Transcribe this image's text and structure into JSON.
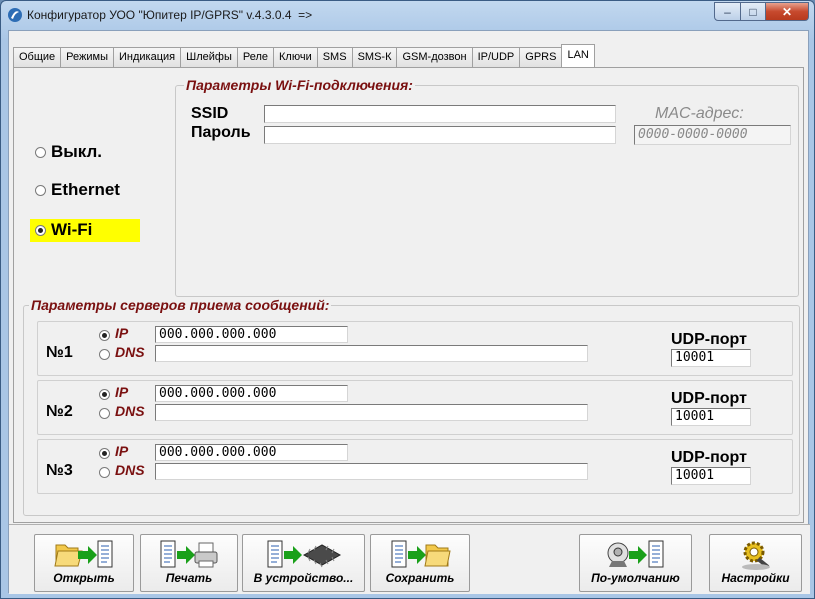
{
  "window": {
    "title": "Конфигуратор УОО \"Юпитер IP/GPRS\" v.4.3.0.4  =>",
    "minimize": "–",
    "maximize": "□",
    "close": "✕"
  },
  "tabs": [
    "Общие",
    "Режимы",
    "Индикация",
    "Шлейфы",
    "Реле",
    "Ключи",
    "SMS",
    "SMS-К",
    "GSM-дозвон",
    "IP/UDP",
    "GPRS",
    "LAN"
  ],
  "active_tab": "LAN",
  "connection": {
    "options": [
      "Выкл.",
      "Ethernet",
      "Wi-Fi"
    ],
    "selected": "Wi-Fi",
    "highlight_color": "#ffff00"
  },
  "wifi": {
    "group_title": "Параметры Wi-Fi-подключения:",
    "ssid_label": "SSID",
    "ssid_value": "",
    "password_label": "Пароль",
    "password_value": "",
    "mac_label": "MAC-адрес:",
    "mac_value": "0000-0000-0000"
  },
  "servers": {
    "group_title": "Параметры серверов приема сообщений:",
    "ip_label": "IP",
    "dns_label": "DNS",
    "udp_label": "UDP-порт",
    "items": [
      {
        "label": "№1",
        "mode": "IP",
        "ip": "000.000.000.000",
        "dns": "",
        "udp_port": "10001"
      },
      {
        "label": "№2",
        "mode": "IP",
        "ip": "000.000.000.000",
        "dns": "",
        "udp_port": "10001"
      },
      {
        "label": "№3",
        "mode": "IP",
        "ip": "000.000.000.000",
        "dns": "",
        "udp_port": "10001"
      }
    ]
  },
  "toolbar": {
    "open": "Открыть",
    "print": "Печать",
    "to_device": "В устройство...",
    "save": "Сохранить",
    "defaults": "По-умолчанию",
    "settings": "Настройки"
  },
  "colors": {
    "accent_label": "#7a1010",
    "arrow": "#1aa01a",
    "folder": "#f2c84a"
  }
}
